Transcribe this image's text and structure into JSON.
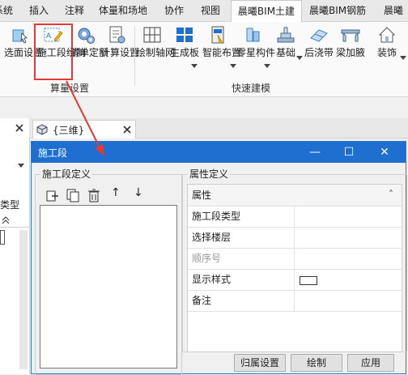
{
  "menu_tabs": [
    {
      "label": "系统"
    },
    {
      "label": "插入"
    },
    {
      "label": "注释"
    },
    {
      "label": "体量和场地"
    },
    {
      "label": "协作"
    },
    {
      "label": "视图"
    },
    {
      "label": "晨曦BIM土建",
      "active": true
    },
    {
      "label": "晨曦BIM钢筋"
    },
    {
      "label": "晨曦"
    }
  ],
  "ribbon": {
    "buttons": [
      {
        "label": "选面设置"
      },
      {
        "label": "施工段绘制"
      },
      {
        "label": "清单定额"
      },
      {
        "label": "计算设置"
      },
      {
        "label": "绘制轴网"
      },
      {
        "label": "生成板"
      },
      {
        "label": "智能布置"
      },
      {
        "label": "零星构件"
      },
      {
        "label": "基础"
      },
      {
        "label": "后浇带"
      },
      {
        "label": "梁加腋"
      },
      {
        "label": "装饰"
      }
    ],
    "groups": [
      {
        "label": "算量设置"
      },
      {
        "label": "快速建模"
      }
    ]
  },
  "left_panel": {
    "type_label": "类型"
  },
  "doc_tab": {
    "label": "{三维}"
  },
  "dialog": {
    "title": "施工段",
    "minimize": "—",
    "maximize": "☐",
    "close": "✕",
    "left_group": "施工段定义",
    "right_group": "属性定义",
    "toolbar": {
      "up": "↑",
      "down": "↓"
    },
    "grid_header": "属性",
    "grid_collapse": "˄",
    "properties": [
      {
        "name": "施工段类型",
        "value": "",
        "disabled": false
      },
      {
        "name": "选择楼层",
        "value": "",
        "disabled": false
      },
      {
        "name": "顺序号",
        "value": "",
        "disabled": true
      },
      {
        "name": "显示样式",
        "value": "",
        "disabled": false,
        "swatch": "#ffffff"
      },
      {
        "name": "备注",
        "value": "",
        "disabled": false
      }
    ],
    "buttons": {
      "assign": "归属设置",
      "draw": "绘制",
      "apply": "应用"
    }
  },
  "colors": {
    "accent": "#1e6fcf",
    "highlight": "#e53935"
  }
}
